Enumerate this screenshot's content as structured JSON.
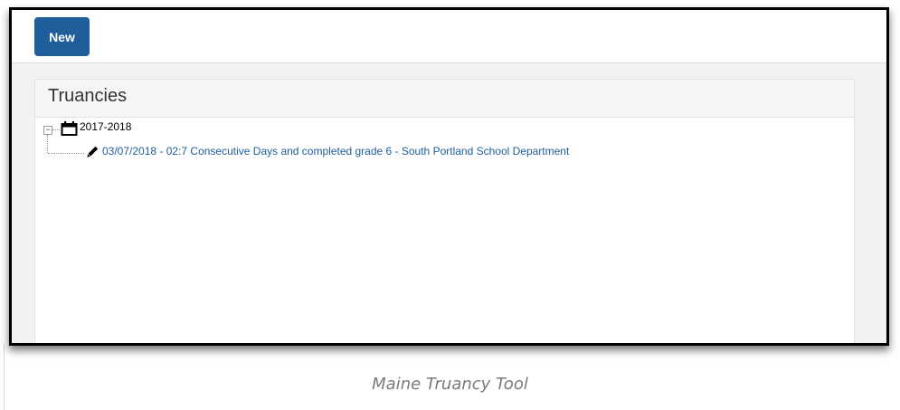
{
  "toolbar": {
    "new_label": "New"
  },
  "panel": {
    "title": "Truancies"
  },
  "tree": {
    "year": {
      "label": "2017-2018",
      "icon": "calendar-icon",
      "toggle": "−"
    },
    "records": [
      {
        "label": "03/07/2018 - 02:7 Consecutive Days and completed grade 6 - South Portland School Department",
        "icon": "pencil-icon"
      }
    ]
  },
  "caption": "Maine Truancy Tool",
  "colors": {
    "accent": "#1f5d9b",
    "link": "#1f5d9b"
  }
}
